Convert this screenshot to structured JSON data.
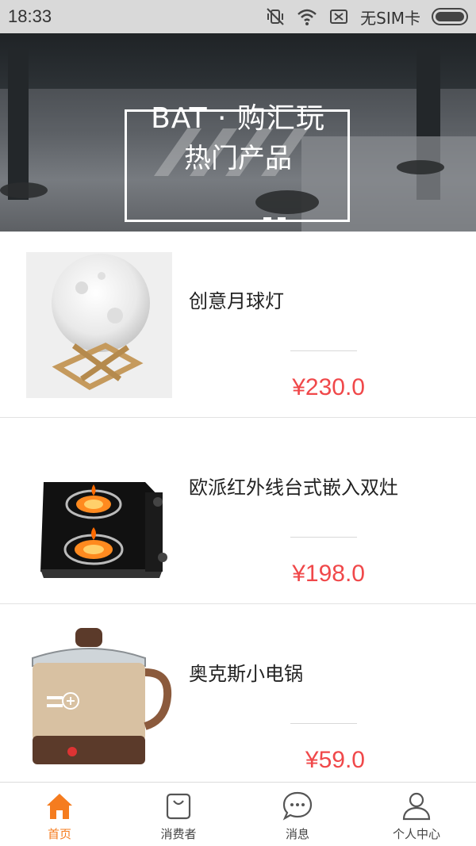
{
  "status_bar": {
    "time": "18:33",
    "sim_text": "无SIM卡",
    "icons": [
      "vibrate-off-icon",
      "wifi-icon",
      "no-sim-icon",
      "battery-icon"
    ]
  },
  "banner": {
    "title": "BAT · 购汇玩",
    "subtitle": "热门产品"
  },
  "products": [
    {
      "name": "创意月球灯",
      "price": "¥230.0",
      "image": "moon-lamp"
    },
    {
      "name": "欧派红外线台式嵌入双灶",
      "price": "¥198.0",
      "image": "gas-stove"
    },
    {
      "name": "奥克斯小电锅",
      "price": "¥59.0",
      "image": "electric-pot"
    }
  ],
  "tabs": [
    {
      "label": "首页",
      "icon": "home-icon",
      "active": true
    },
    {
      "label": "消费者",
      "icon": "shopping-bag-icon",
      "active": false
    },
    {
      "label": "消息",
      "icon": "chat-bubble-icon",
      "active": false
    },
    {
      "label": "个人中心",
      "icon": "user-icon",
      "active": false
    }
  ],
  "colors": {
    "accent": "#f57c1f",
    "price": "#f0484a",
    "status_bar": "#d9d9d9"
  }
}
